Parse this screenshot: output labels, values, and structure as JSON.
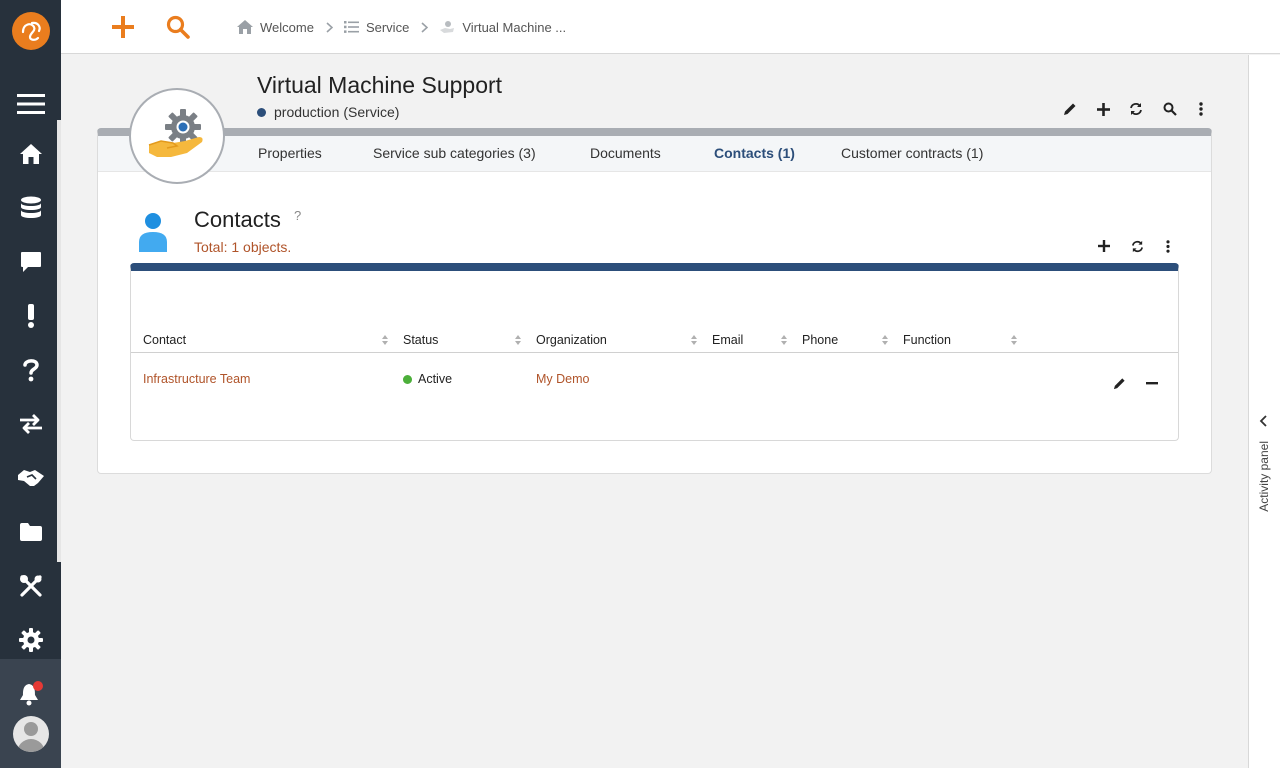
{
  "breadcrumb": [
    {
      "label": "Welcome",
      "icon": "home-icon"
    },
    {
      "label": "Service",
      "icon": "list-icon"
    },
    {
      "label": "Virtual Machine ...",
      "icon": "service-icon"
    }
  ],
  "object": {
    "title": "Virtual Machine Support",
    "status_label": "production",
    "class_label": "(Service)"
  },
  "tabs": [
    {
      "label": "Properties",
      "active": false
    },
    {
      "label": "Service sub categories (3)",
      "active": false
    },
    {
      "label": "Documents",
      "active": false
    },
    {
      "label": "Contacts (1)",
      "active": true
    },
    {
      "label": "Customer contracts (1)",
      "active": false
    }
  ],
  "contacts": {
    "title": "Contacts",
    "help": "?",
    "total": "Total: 1 objects.",
    "columns": [
      "Contact",
      "Status",
      "Organization",
      "Email",
      "Phone",
      "Function"
    ],
    "rows": [
      {
        "contact": "Infrastructure Team",
        "status": "Active",
        "organization": "My Demo",
        "email": "",
        "phone": "",
        "function": ""
      }
    ]
  },
  "activity_panel": {
    "label": "Activity panel"
  },
  "colors": {
    "accent": "#ea7d1e",
    "sidebar": "#27313c",
    "primary": "#2c4e7a",
    "link": "#b0542a",
    "active_status": "#4caf3a",
    "notification": "#e53935"
  }
}
